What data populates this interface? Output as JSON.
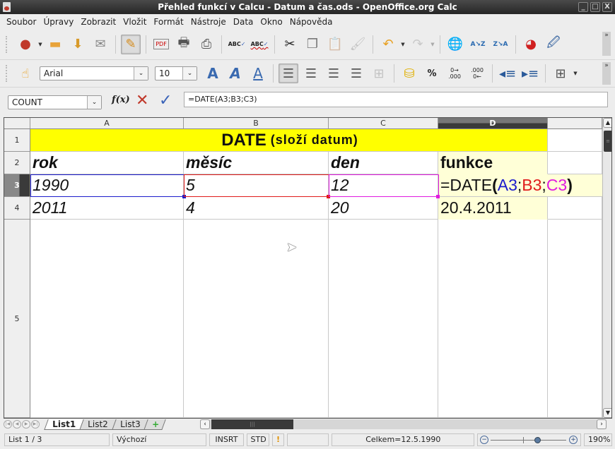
{
  "window": {
    "title": "Přehled funkcí v Calcu - Datum a čas.ods - OpenOffice.org Calc",
    "buttons": {
      "minimize": "_",
      "maximize": "□",
      "close": "X"
    }
  },
  "menubar": {
    "items": [
      "Soubor",
      "Úpravy",
      "Zobrazit",
      "Vložit",
      "Formát",
      "Nástroje",
      "Data",
      "Okno",
      "Nápověda"
    ]
  },
  "standard_toolbar": {
    "icons": [
      "new-document-icon",
      "open-icon",
      "save-icon",
      "email-icon",
      "edit-mode-icon",
      "export-pdf-icon",
      "print-icon",
      "print-preview-icon",
      "spellcheck-icon",
      "autospellcheck-icon",
      "cut-icon",
      "copy-icon",
      "paste-icon",
      "format-paintbrush-icon",
      "undo-icon",
      "redo-icon",
      "hyperlink-icon",
      "sort-ascending-icon",
      "sort-descending-icon",
      "chart-icon",
      "show-draw-functions-icon"
    ],
    "more": "»"
  },
  "formatting_toolbar": {
    "font_name": "Arial",
    "font_size": "10",
    "more": "»"
  },
  "formula_bar": {
    "name_box": "COUNT",
    "function_wizard": "f(x)",
    "formula": "=DATE(A3;B3;C3)"
  },
  "sheet": {
    "columns": [
      "A",
      "B",
      "C",
      "D"
    ],
    "selected_column": "D",
    "rows": [
      "1",
      "2",
      "3",
      "4",
      "5"
    ],
    "selected_row": "3",
    "title": {
      "main": "DATE",
      "sub": "(složí datum)"
    },
    "headers": {
      "A2": "rok",
      "B2": "měsíc",
      "C2": "den",
      "D2": "funkce"
    },
    "values": {
      "A3": "1990",
      "B3": "5",
      "C3": "12",
      "A4": "2011",
      "B4": "4",
      "C4": "20",
      "D4": "20.4.2011"
    },
    "edit_formula": {
      "prefix": "=DATE(",
      "ref1": "A3",
      "sep1": ";",
      "ref2": "B3",
      "sep2": ";",
      "ref3": "C3",
      "suffix": ")"
    },
    "colors": {
      "title_bg": "#ffff00",
      "function_bg": "#ffffd7",
      "ref_a": "#1c1ccc",
      "ref_b": "#e01b1b",
      "ref_c": "#e01be0"
    }
  },
  "sheet_tabs": {
    "tabs": [
      "List1",
      "List2",
      "List3"
    ],
    "active": "List1",
    "add": "+"
  },
  "statusbar": {
    "sheet_pos": "List 1 / 3",
    "page_style": "Výchozí",
    "insert_mode": "INSRT",
    "selection_mode": "STD",
    "modified": "!",
    "sum": "Celkem=12.5.1990",
    "zoom_percent": "190%",
    "zoom_value": 190
  }
}
